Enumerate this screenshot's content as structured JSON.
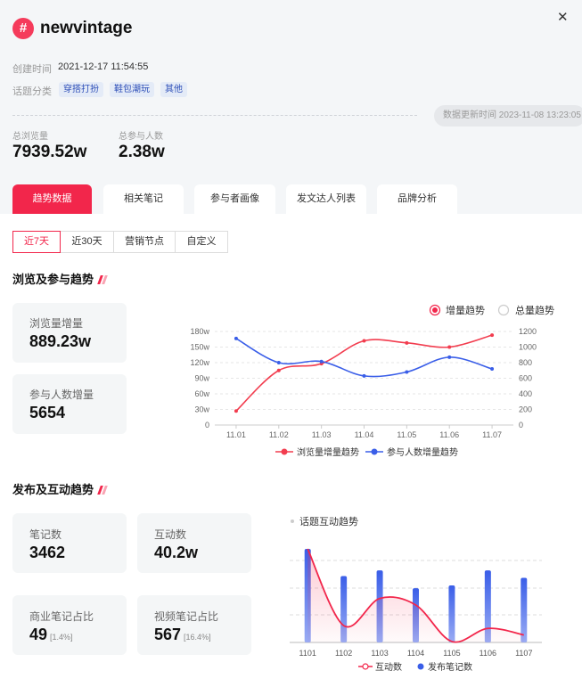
{
  "header": {
    "hash_glyph": "#",
    "title": "newvintage"
  },
  "meta": {
    "created_label": "创建时间",
    "created_value": "2021-12-17 11:54:55",
    "category_label": "话题分类",
    "tags": [
      "穿搭打扮",
      "鞋包潮玩",
      "其他"
    ],
    "update_text": "数据更新时间 2023-11-08 13:23:05"
  },
  "summary": {
    "views_label": "总浏览量",
    "views_value": "7939.52w",
    "participants_label": "总参与人数",
    "participants_value": "2.38w"
  },
  "tabs": [
    "趋势数据",
    "相关笔记",
    "参与者画像",
    "发文达人列表",
    "品牌分析"
  ],
  "ranges": [
    "近7天",
    "近30天",
    "营销节点",
    "自定义"
  ],
  "trend": {
    "title": "浏览及参与趋势",
    "card1_label": "浏览量增量",
    "card1_value": "889.23w",
    "card2_label": "参与人数增量",
    "card2_value": "5654",
    "toggle_incr": "增量趋势",
    "toggle_total": "总量趋势"
  },
  "interact": {
    "title": "发布及互动趋势",
    "notes_label": "笔记数",
    "notes_value": "3462",
    "interact_label": "互动数",
    "interact_value": "40.2w",
    "biz_label": "商业笔记占比",
    "biz_value": "49",
    "biz_pct": "[1.4%]",
    "video_label": "视频笔记占比",
    "video_value": "567",
    "video_pct": "[16.4%]"
  },
  "chart_data": [
    {
      "type": "line",
      "x": [
        "11.01",
        "11.02",
        "11.03",
        "11.04",
        "11.05",
        "11.06",
        "11.07"
      ],
      "y_left_ticks": [
        "0",
        "30w",
        "60w",
        "90w",
        "120w",
        "150w",
        "180w"
      ],
      "y_right_ticks": [
        "0",
        "200",
        "400",
        "600",
        "800",
        "1000",
        "1200"
      ],
      "ylim_left": [
        0,
        180
      ],
      "ylim_right": [
        0,
        1200
      ],
      "series": [
        {
          "name": "浏览量增量趋势",
          "color": "#f23d4f",
          "axis": "left",
          "values": [
            27,
            105,
            118,
            162,
            158,
            150,
            173
          ]
        },
        {
          "name": "参与人数增量趋势",
          "color": "#3a5ee8",
          "axis": "right",
          "values": [
            1110,
            800,
            815,
            630,
            680,
            870,
            720
          ]
        }
      ],
      "legend": "bottom",
      "grid": true
    },
    {
      "type": "bar",
      "title": "话题互动趋势",
      "categories": [
        "1101",
        "1102",
        "1103",
        "1104",
        "1105",
        "1106",
        "1107"
      ],
      "series": [
        {
          "name": "互动数",
          "type": "line",
          "color": "#f2264b",
          "values": [
            100,
            18,
            47,
            40,
            1,
            15,
            8
          ]
        },
        {
          "name": "发布笔记数",
          "type": "bar",
          "color": "#3a5ee8",
          "values": [
            100,
            71,
            77,
            58,
            61,
            77,
            69
          ]
        }
      ],
      "ylim": [
        0,
        100
      ],
      "legend": "bottom",
      "grid": true
    }
  ]
}
